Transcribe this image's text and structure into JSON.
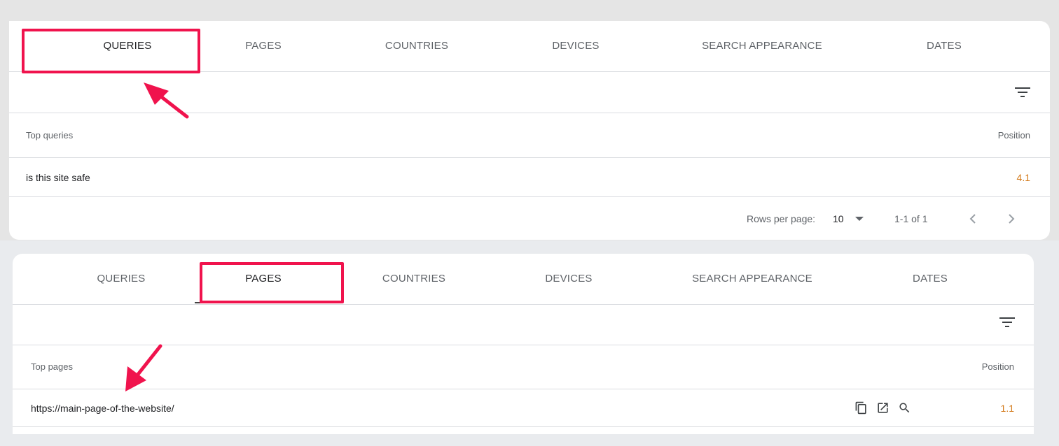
{
  "tabs": [
    "QUERIES",
    "PAGES",
    "COUNTRIES",
    "DEVICES",
    "SEARCH APPEARANCE",
    "DATES"
  ],
  "panel_queries": {
    "active_tab": "QUERIES",
    "header": {
      "left": "Top queries",
      "right": "Position"
    },
    "rows": [
      {
        "label": "is this site safe",
        "position": "4.1"
      }
    ],
    "pagination": {
      "rows_per_page_label": "Rows per page:",
      "rows_per_page_value": "10",
      "range": "1-1 of 1"
    }
  },
  "panel_pages": {
    "active_tab": "PAGES",
    "header": {
      "left": "Top pages",
      "right": "Position"
    },
    "rows": [
      {
        "label": "https://main-page-of-the-website/",
        "position": "1.1"
      }
    ]
  },
  "icons": {
    "filter": "filter-list-icon",
    "copy": "copy-icon",
    "open": "open-in-new-icon",
    "inspect": "search-icon",
    "prev": "chevron-left-icon",
    "next": "chevron-right-icon"
  },
  "colors": {
    "highlight": "#f0134d",
    "position_value": "#d37a1b"
  }
}
